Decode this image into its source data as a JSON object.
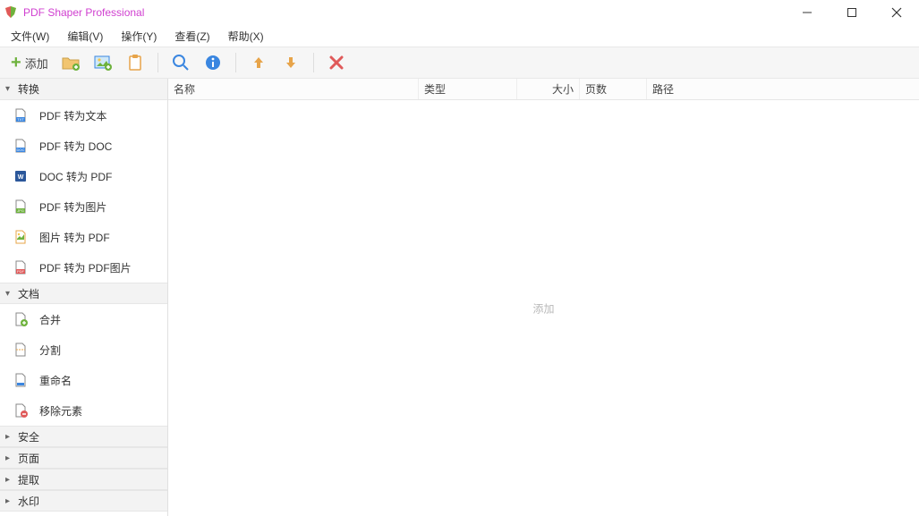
{
  "app": {
    "title": "PDF Shaper Professional"
  },
  "menu": {
    "file": "文件(W)",
    "edit": "编辑(V)",
    "action": "操作(Y)",
    "view": "查看(Z)",
    "help": "帮助(X)"
  },
  "toolbar": {
    "add_label": "添加"
  },
  "sidebar": {
    "groups": [
      {
        "key": "convert",
        "label": "转换",
        "expanded": true
      },
      {
        "key": "document",
        "label": "文档",
        "expanded": true
      },
      {
        "key": "security",
        "label": "安全",
        "expanded": false
      },
      {
        "key": "pages",
        "label": "页面",
        "expanded": false
      },
      {
        "key": "extract",
        "label": "提取",
        "expanded": false
      },
      {
        "key": "watermark",
        "label": "水印",
        "expanded": false
      }
    ],
    "convert_items": [
      {
        "label": "PDF 转为文本",
        "icon": "txt"
      },
      {
        "label": "PDF 转为 DOC",
        "icon": "doc"
      },
      {
        "label": "DOC 转为 PDF",
        "icon": "word"
      },
      {
        "label": "PDF 转为图片",
        "icon": "jpg"
      },
      {
        "label": "图片 转为 PDF",
        "icon": "img2pdf"
      },
      {
        "label": "PDF 转为 PDF图片",
        "icon": "pdf"
      }
    ],
    "document_items": [
      {
        "label": "合并",
        "icon": "merge"
      },
      {
        "label": "分割",
        "icon": "split"
      },
      {
        "label": "重命名",
        "icon": "rename"
      },
      {
        "label": "移除元素",
        "icon": "remove"
      }
    ]
  },
  "list": {
    "columns": {
      "name": "名称",
      "type": "类型",
      "size": "大小",
      "pages": "页数",
      "path": "路径"
    },
    "placeholder": "添加",
    "rows": []
  }
}
